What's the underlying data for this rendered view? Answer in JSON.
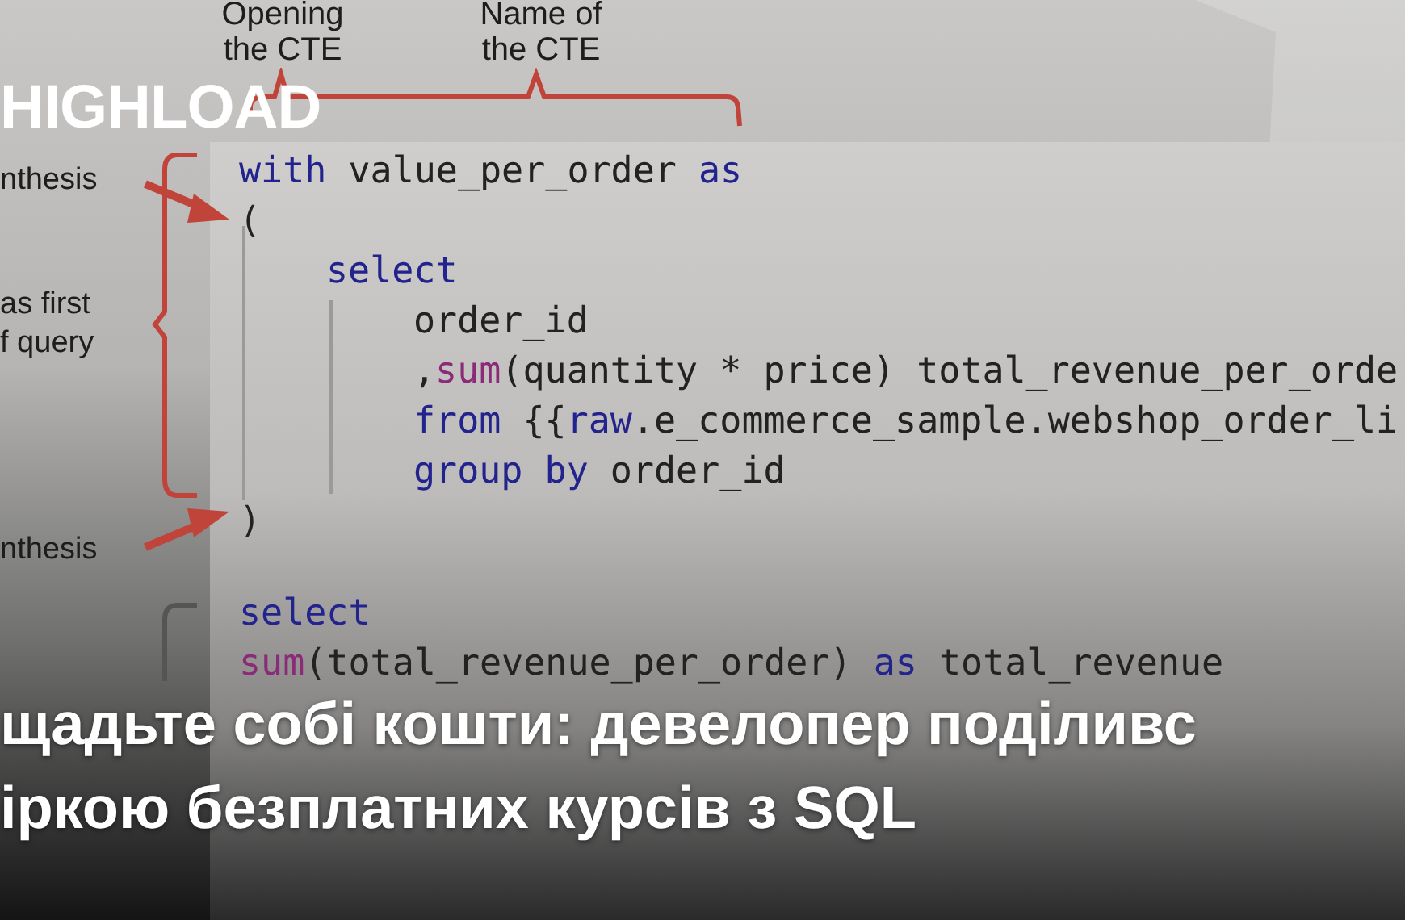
{
  "brand": "HIGHLOAD",
  "diagram": {
    "top_labels": [
      {
        "lines": [
          "Opening",
          "the CTE"
        ]
      },
      {
        "lines": [
          "Name of",
          "the CTE"
        ]
      }
    ],
    "side_labels": [
      {
        "lines": [
          "nthesis"
        ]
      },
      {
        "lines": [
          "as first",
          "f query"
        ]
      },
      {
        "lines": [
          "nthesis"
        ]
      }
    ]
  },
  "code": [
    {
      "lines": [
        {
          "tokens": [
            {
              "kind": "keyword",
              "text": "with"
            },
            {
              "kind": "plain",
              "text": " value_per_order "
            },
            {
              "kind": "keyword",
              "text": "as"
            }
          ]
        },
        {
          "tokens": [
            {
              "kind": "plain",
              "text": "("
            }
          ],
          "children": [
            {
              "tokens": [
                {
                  "kind": "keyword",
                  "text": "select"
                }
              ],
              "children": [
                {
                  "tokens": [
                    {
                      "kind": "plain",
                      "text": "order_id"
                    }
                  ]
                },
                {
                  "tokens": [
                    {
                      "kind": "plain",
                      "text": ","
                    },
                    {
                      "kind": "function",
                      "text": "sum"
                    },
                    {
                      "kind": "plain",
                      "text": "(quantity * price) total_revenue_per_orde"
                    }
                  ]
                },
                {
                  "tokens": [
                    {
                      "kind": "keyword",
                      "text": "from"
                    },
                    {
                      "kind": "plain",
                      "text": " {{"
                    },
                    {
                      "kind": "keyword",
                      "text": "raw"
                    },
                    {
                      "kind": "plain",
                      "text": ".e_commerce_sample.webshop_order_li"
                    }
                  ]
                },
                {
                  "tokens": [
                    {
                      "kind": "keyword",
                      "text": "group by"
                    },
                    {
                      "kind": "plain",
                      "text": " order_id"
                    }
                  ]
                }
              ]
            }
          ]
        },
        {
          "tokens": [
            {
              "kind": "plain",
              "text": ")"
            }
          ]
        }
      ]
    },
    {
      "lines": [
        {
          "tokens": [
            {
              "kind": "keyword",
              "text": "select"
            }
          ]
        },
        {
          "tokens": [
            {
              "kind": "function",
              "text": "sum"
            },
            {
              "kind": "plain",
              "text": "(total_revenue_per_order) "
            },
            {
              "kind": "keyword",
              "text": "as"
            },
            {
              "kind": "plain",
              "text": " total_revenue"
            }
          ]
        }
      ]
    }
  ],
  "headline": [
    "щадьте собі кошти: девелопер поділивс",
    "іркою безплатних курсів з SQL"
  ]
}
